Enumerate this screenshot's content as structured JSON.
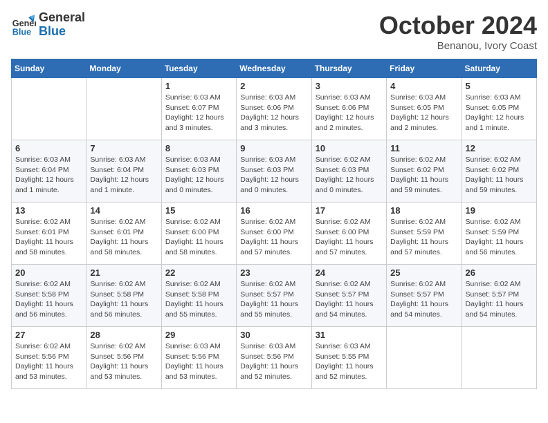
{
  "header": {
    "logo_line1": "General",
    "logo_line2": "Blue",
    "month": "October 2024",
    "location": "Benanou, Ivory Coast"
  },
  "weekdays": [
    "Sunday",
    "Monday",
    "Tuesday",
    "Wednesday",
    "Thursday",
    "Friday",
    "Saturday"
  ],
  "weeks": [
    [
      {
        "day": "",
        "info": ""
      },
      {
        "day": "",
        "info": ""
      },
      {
        "day": "1",
        "info": "Sunrise: 6:03 AM\nSunset: 6:07 PM\nDaylight: 12 hours and 3 minutes."
      },
      {
        "day": "2",
        "info": "Sunrise: 6:03 AM\nSunset: 6:06 PM\nDaylight: 12 hours and 3 minutes."
      },
      {
        "day": "3",
        "info": "Sunrise: 6:03 AM\nSunset: 6:06 PM\nDaylight: 12 hours and 2 minutes."
      },
      {
        "day": "4",
        "info": "Sunrise: 6:03 AM\nSunset: 6:05 PM\nDaylight: 12 hours and 2 minutes."
      },
      {
        "day": "5",
        "info": "Sunrise: 6:03 AM\nSunset: 6:05 PM\nDaylight: 12 hours and 1 minute."
      }
    ],
    [
      {
        "day": "6",
        "info": "Sunrise: 6:03 AM\nSunset: 6:04 PM\nDaylight: 12 hours and 1 minute."
      },
      {
        "day": "7",
        "info": "Sunrise: 6:03 AM\nSunset: 6:04 PM\nDaylight: 12 hours and 1 minute."
      },
      {
        "day": "8",
        "info": "Sunrise: 6:03 AM\nSunset: 6:03 PM\nDaylight: 12 hours and 0 minutes."
      },
      {
        "day": "9",
        "info": "Sunrise: 6:03 AM\nSunset: 6:03 PM\nDaylight: 12 hours and 0 minutes."
      },
      {
        "day": "10",
        "info": "Sunrise: 6:02 AM\nSunset: 6:03 PM\nDaylight: 12 hours and 0 minutes."
      },
      {
        "day": "11",
        "info": "Sunrise: 6:02 AM\nSunset: 6:02 PM\nDaylight: 11 hours and 59 minutes."
      },
      {
        "day": "12",
        "info": "Sunrise: 6:02 AM\nSunset: 6:02 PM\nDaylight: 11 hours and 59 minutes."
      }
    ],
    [
      {
        "day": "13",
        "info": "Sunrise: 6:02 AM\nSunset: 6:01 PM\nDaylight: 11 hours and 58 minutes."
      },
      {
        "day": "14",
        "info": "Sunrise: 6:02 AM\nSunset: 6:01 PM\nDaylight: 11 hours and 58 minutes."
      },
      {
        "day": "15",
        "info": "Sunrise: 6:02 AM\nSunset: 6:00 PM\nDaylight: 11 hours and 58 minutes."
      },
      {
        "day": "16",
        "info": "Sunrise: 6:02 AM\nSunset: 6:00 PM\nDaylight: 11 hours and 57 minutes."
      },
      {
        "day": "17",
        "info": "Sunrise: 6:02 AM\nSunset: 6:00 PM\nDaylight: 11 hours and 57 minutes."
      },
      {
        "day": "18",
        "info": "Sunrise: 6:02 AM\nSunset: 5:59 PM\nDaylight: 11 hours and 57 minutes."
      },
      {
        "day": "19",
        "info": "Sunrise: 6:02 AM\nSunset: 5:59 PM\nDaylight: 11 hours and 56 minutes."
      }
    ],
    [
      {
        "day": "20",
        "info": "Sunrise: 6:02 AM\nSunset: 5:58 PM\nDaylight: 11 hours and 56 minutes."
      },
      {
        "day": "21",
        "info": "Sunrise: 6:02 AM\nSunset: 5:58 PM\nDaylight: 11 hours and 56 minutes."
      },
      {
        "day": "22",
        "info": "Sunrise: 6:02 AM\nSunset: 5:58 PM\nDaylight: 11 hours and 55 minutes."
      },
      {
        "day": "23",
        "info": "Sunrise: 6:02 AM\nSunset: 5:57 PM\nDaylight: 11 hours and 55 minutes."
      },
      {
        "day": "24",
        "info": "Sunrise: 6:02 AM\nSunset: 5:57 PM\nDaylight: 11 hours and 54 minutes."
      },
      {
        "day": "25",
        "info": "Sunrise: 6:02 AM\nSunset: 5:57 PM\nDaylight: 11 hours and 54 minutes."
      },
      {
        "day": "26",
        "info": "Sunrise: 6:02 AM\nSunset: 5:57 PM\nDaylight: 11 hours and 54 minutes."
      }
    ],
    [
      {
        "day": "27",
        "info": "Sunrise: 6:02 AM\nSunset: 5:56 PM\nDaylight: 11 hours and 53 minutes."
      },
      {
        "day": "28",
        "info": "Sunrise: 6:02 AM\nSunset: 5:56 PM\nDaylight: 11 hours and 53 minutes."
      },
      {
        "day": "29",
        "info": "Sunrise: 6:03 AM\nSunset: 5:56 PM\nDaylight: 11 hours and 53 minutes."
      },
      {
        "day": "30",
        "info": "Sunrise: 6:03 AM\nSunset: 5:56 PM\nDaylight: 11 hours and 52 minutes."
      },
      {
        "day": "31",
        "info": "Sunrise: 6:03 AM\nSunset: 5:55 PM\nDaylight: 11 hours and 52 minutes."
      },
      {
        "day": "",
        "info": ""
      },
      {
        "day": "",
        "info": ""
      }
    ]
  ]
}
